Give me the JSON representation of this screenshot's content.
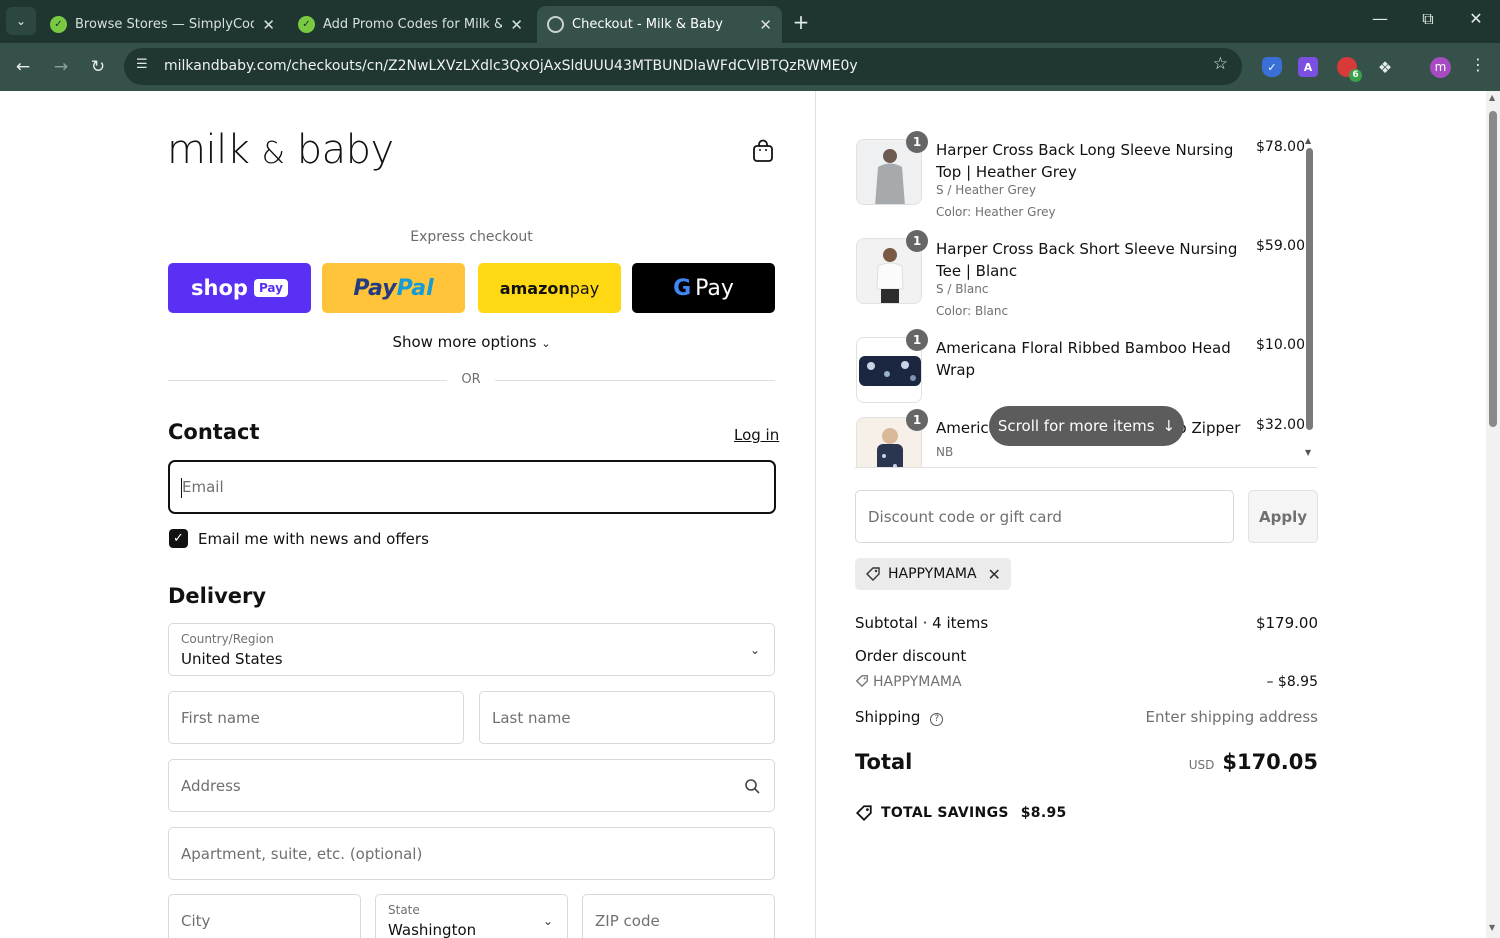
{
  "browser": {
    "tabs": [
      {
        "title": "Browse Stores — SimplyCodes",
        "active": false
      },
      {
        "title": "Add Promo Codes for Milk & Ba",
        "active": false
      },
      {
        "title": "Checkout - Milk & Baby",
        "active": true
      }
    ],
    "url": "milkandbaby.com/checkouts/cn/Z2NwLXVzLXdlc3QxOjAxSldUUU43MTBUNDlaWFdCVlBTQzRWME0y",
    "extension_badge": "6",
    "profile_initial": "m",
    "extension_letter": "A"
  },
  "store": {
    "logo_main": "milk",
    "logo_amp": "&",
    "logo_tail": "baby"
  },
  "express": {
    "label": "Express checkout",
    "shop_pay": "shop",
    "shop_pay_chip": "Pay",
    "paypal_a": "Pay",
    "paypal_b": "Pal",
    "amazon_a": "amazon",
    "amazon_b": " pay",
    "gpay_g": "G",
    "gpay_text": "Pay",
    "show_more": "Show more options",
    "or": "OR"
  },
  "contact": {
    "heading": "Contact",
    "login": "Log in",
    "email_placeholder": "Email",
    "newsletter_label": "Email me with news and offers",
    "newsletter_checked": true
  },
  "delivery": {
    "heading": "Delivery",
    "country_label": "Country/Region",
    "country_value": "United States",
    "first_name": "First name",
    "last_name": "Last name",
    "address": "Address",
    "apartment": "Apartment, suite, etc. (optional)",
    "city": "City",
    "state_label": "State",
    "state_value": "Washington",
    "zip": "ZIP code"
  },
  "items": [
    {
      "qty": "1",
      "name": "Harper Cross Back Long Sleeve Nursing Top | Heather Grey",
      "variant": "S / Heather Grey",
      "color": "Color: Heather Grey",
      "price": "$78.00"
    },
    {
      "qty": "1",
      "name": "Harper Cross Back Short Sleeve Nursing Tee | Blanc",
      "variant": "S / Blanc",
      "color": "Color: Blanc",
      "price": "$59.00"
    },
    {
      "qty": "1",
      "name": "Americana Floral Ribbed Bamboo Head Wrap",
      "variant": "",
      "color": "",
      "price": "$10.00"
    },
    {
      "qty": "1",
      "name": "Americana Floral Ribbed Bamboo Zipper",
      "variant": "NB",
      "color": "",
      "price": "$32.00"
    }
  ],
  "summary": {
    "scroll_hint": "Scroll for more items",
    "discount_placeholder": "Discount code or gift card",
    "apply": "Apply",
    "applied_code": "HAPPYMAMA",
    "subtotal_label": "Subtotal · 4 items",
    "subtotal_value": "$179.00",
    "order_discount_label": "Order discount",
    "discount_code": "HAPPYMAMA",
    "discount_value": "– $8.95",
    "shipping_label": "Shipping",
    "shipping_value": "Enter shipping address",
    "total_label": "Total",
    "currency": "USD",
    "total_value": "$170.05",
    "savings_label": "TOTAL SAVINGS",
    "savings_value": "$8.95"
  }
}
